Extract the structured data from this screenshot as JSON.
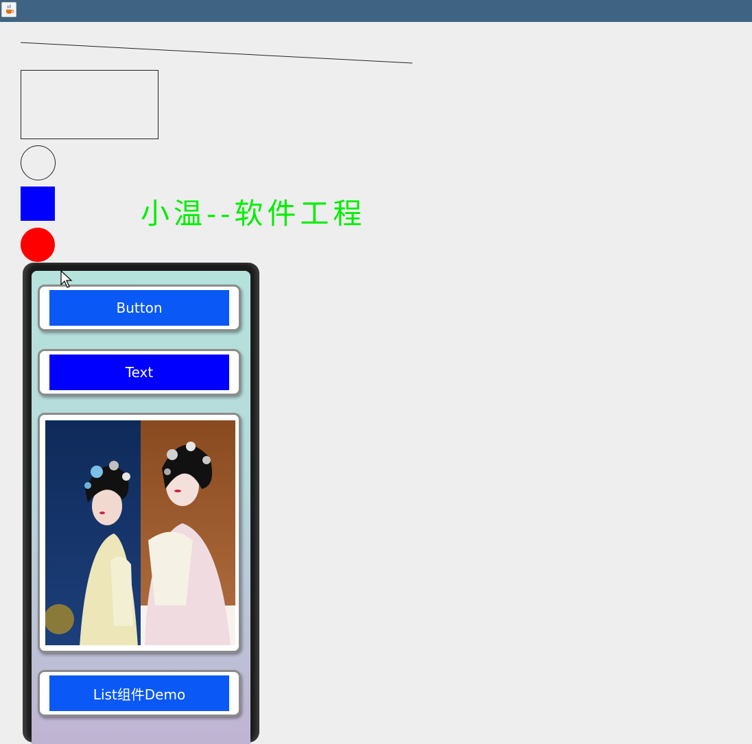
{
  "window": {
    "app_icon": "java-cup-icon"
  },
  "canvas": {
    "line_color": "#222222",
    "rect_color": "#222222",
    "circle_color": "#222222",
    "square_fill": "#0000ff",
    "red_circle_fill": "#ff0000",
    "headline": "小温--软件工程",
    "headline_color": "#00ee00"
  },
  "phone": {
    "button_label": "Button",
    "button_color": "#0a58f5",
    "text_label": "Text",
    "text_color": "#0000ff",
    "image_icon": "peking-opera-performers-photo",
    "list_label": "List组件Demo",
    "list_color": "#0a58f5"
  },
  "cursor": {
    "icon": "mouse-pointer-icon"
  }
}
